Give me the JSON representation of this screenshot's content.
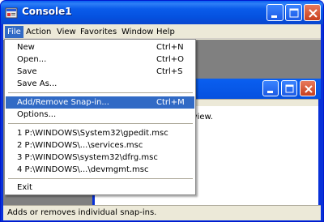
{
  "window": {
    "title": "Console1",
    "icon": "mmc-console-icon"
  },
  "caption_buttons": [
    "minimize",
    "maximize",
    "close"
  ],
  "menubar": {
    "file": "File",
    "action": "Action",
    "view": "View",
    "favorites": "Favorites",
    "window": "Window",
    "help": "Help"
  },
  "child_window": {
    "body_text": "ns to show in this view."
  },
  "status_bar": "Adds or removes individual snap-ins.",
  "file_menu": {
    "new": {
      "label": "New",
      "shortcut": "Ctrl+N"
    },
    "open": {
      "label": "Open...",
      "shortcut": "Ctrl+O"
    },
    "save": {
      "label": "Save",
      "shortcut": "Ctrl+S"
    },
    "save_as": {
      "label": "Save As..."
    },
    "add_remove": {
      "label": "Add/Remove Snap-in...",
      "shortcut": "Ctrl+M",
      "selected": true
    },
    "options": {
      "label": "Options..."
    },
    "recent": [
      "1 P:\\WINDOWS\\System32\\gpedit.msc",
      "2 P:\\WINDOWS\\...\\services.msc",
      "3 P:\\WINDOWS\\system32\\dfrg.msc",
      "4 P:\\WINDOWS\\...\\devmgmt.msc"
    ],
    "exit": {
      "label": "Exit"
    }
  },
  "colors": {
    "titlebar": "#0a5bea",
    "menu_highlight": "#316ac5",
    "face": "#ece9d8",
    "close_button": "#d24d2b"
  }
}
